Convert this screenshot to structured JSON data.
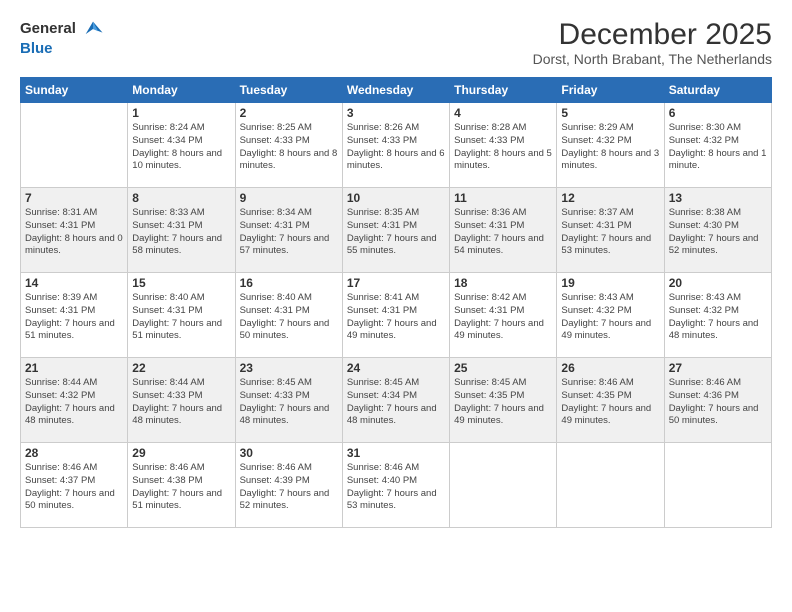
{
  "logo": {
    "text_general": "General",
    "text_blue": "Blue"
  },
  "header": {
    "title": "December 2025",
    "subtitle": "Dorst, North Brabant, The Netherlands"
  },
  "weekdays": [
    "Sunday",
    "Monday",
    "Tuesday",
    "Wednesday",
    "Thursday",
    "Friday",
    "Saturday"
  ],
  "weeks": [
    [
      {
        "day": "",
        "sunrise": "",
        "sunset": "",
        "daylight": ""
      },
      {
        "day": "1",
        "sunrise": "Sunrise: 8:24 AM",
        "sunset": "Sunset: 4:34 PM",
        "daylight": "Daylight: 8 hours and 10 minutes."
      },
      {
        "day": "2",
        "sunrise": "Sunrise: 8:25 AM",
        "sunset": "Sunset: 4:33 PM",
        "daylight": "Daylight: 8 hours and 8 minutes."
      },
      {
        "day": "3",
        "sunrise": "Sunrise: 8:26 AM",
        "sunset": "Sunset: 4:33 PM",
        "daylight": "Daylight: 8 hours and 6 minutes."
      },
      {
        "day": "4",
        "sunrise": "Sunrise: 8:28 AM",
        "sunset": "Sunset: 4:33 PM",
        "daylight": "Daylight: 8 hours and 5 minutes."
      },
      {
        "day": "5",
        "sunrise": "Sunrise: 8:29 AM",
        "sunset": "Sunset: 4:32 PM",
        "daylight": "Daylight: 8 hours and 3 minutes."
      },
      {
        "day": "6",
        "sunrise": "Sunrise: 8:30 AM",
        "sunset": "Sunset: 4:32 PM",
        "daylight": "Daylight: 8 hours and 1 minute."
      }
    ],
    [
      {
        "day": "7",
        "sunrise": "Sunrise: 8:31 AM",
        "sunset": "Sunset: 4:31 PM",
        "daylight": "Daylight: 8 hours and 0 minutes."
      },
      {
        "day": "8",
        "sunrise": "Sunrise: 8:33 AM",
        "sunset": "Sunset: 4:31 PM",
        "daylight": "Daylight: 7 hours and 58 minutes."
      },
      {
        "day": "9",
        "sunrise": "Sunrise: 8:34 AM",
        "sunset": "Sunset: 4:31 PM",
        "daylight": "Daylight: 7 hours and 57 minutes."
      },
      {
        "day": "10",
        "sunrise": "Sunrise: 8:35 AM",
        "sunset": "Sunset: 4:31 PM",
        "daylight": "Daylight: 7 hours and 55 minutes."
      },
      {
        "day": "11",
        "sunrise": "Sunrise: 8:36 AM",
        "sunset": "Sunset: 4:31 PM",
        "daylight": "Daylight: 7 hours and 54 minutes."
      },
      {
        "day": "12",
        "sunrise": "Sunrise: 8:37 AM",
        "sunset": "Sunset: 4:31 PM",
        "daylight": "Daylight: 7 hours and 53 minutes."
      },
      {
        "day": "13",
        "sunrise": "Sunrise: 8:38 AM",
        "sunset": "Sunset: 4:30 PM",
        "daylight": "Daylight: 7 hours and 52 minutes."
      }
    ],
    [
      {
        "day": "14",
        "sunrise": "Sunrise: 8:39 AM",
        "sunset": "Sunset: 4:31 PM",
        "daylight": "Daylight: 7 hours and 51 minutes."
      },
      {
        "day": "15",
        "sunrise": "Sunrise: 8:40 AM",
        "sunset": "Sunset: 4:31 PM",
        "daylight": "Daylight: 7 hours and 51 minutes."
      },
      {
        "day": "16",
        "sunrise": "Sunrise: 8:40 AM",
        "sunset": "Sunset: 4:31 PM",
        "daylight": "Daylight: 7 hours and 50 minutes."
      },
      {
        "day": "17",
        "sunrise": "Sunrise: 8:41 AM",
        "sunset": "Sunset: 4:31 PM",
        "daylight": "Daylight: 7 hours and 49 minutes."
      },
      {
        "day": "18",
        "sunrise": "Sunrise: 8:42 AM",
        "sunset": "Sunset: 4:31 PM",
        "daylight": "Daylight: 7 hours and 49 minutes."
      },
      {
        "day": "19",
        "sunrise": "Sunrise: 8:43 AM",
        "sunset": "Sunset: 4:32 PM",
        "daylight": "Daylight: 7 hours and 49 minutes."
      },
      {
        "day": "20",
        "sunrise": "Sunrise: 8:43 AM",
        "sunset": "Sunset: 4:32 PM",
        "daylight": "Daylight: 7 hours and 48 minutes."
      }
    ],
    [
      {
        "day": "21",
        "sunrise": "Sunrise: 8:44 AM",
        "sunset": "Sunset: 4:32 PM",
        "daylight": "Daylight: 7 hours and 48 minutes."
      },
      {
        "day": "22",
        "sunrise": "Sunrise: 8:44 AM",
        "sunset": "Sunset: 4:33 PM",
        "daylight": "Daylight: 7 hours and 48 minutes."
      },
      {
        "day": "23",
        "sunrise": "Sunrise: 8:45 AM",
        "sunset": "Sunset: 4:33 PM",
        "daylight": "Daylight: 7 hours and 48 minutes."
      },
      {
        "day": "24",
        "sunrise": "Sunrise: 8:45 AM",
        "sunset": "Sunset: 4:34 PM",
        "daylight": "Daylight: 7 hours and 48 minutes."
      },
      {
        "day": "25",
        "sunrise": "Sunrise: 8:45 AM",
        "sunset": "Sunset: 4:35 PM",
        "daylight": "Daylight: 7 hours and 49 minutes."
      },
      {
        "day": "26",
        "sunrise": "Sunrise: 8:46 AM",
        "sunset": "Sunset: 4:35 PM",
        "daylight": "Daylight: 7 hours and 49 minutes."
      },
      {
        "day": "27",
        "sunrise": "Sunrise: 8:46 AM",
        "sunset": "Sunset: 4:36 PM",
        "daylight": "Daylight: 7 hours and 50 minutes."
      }
    ],
    [
      {
        "day": "28",
        "sunrise": "Sunrise: 8:46 AM",
        "sunset": "Sunset: 4:37 PM",
        "daylight": "Daylight: 7 hours and 50 minutes."
      },
      {
        "day": "29",
        "sunrise": "Sunrise: 8:46 AM",
        "sunset": "Sunset: 4:38 PM",
        "daylight": "Daylight: 7 hours and 51 minutes."
      },
      {
        "day": "30",
        "sunrise": "Sunrise: 8:46 AM",
        "sunset": "Sunset: 4:39 PM",
        "daylight": "Daylight: 7 hours and 52 minutes."
      },
      {
        "day": "31",
        "sunrise": "Sunrise: 8:46 AM",
        "sunset": "Sunset: 4:40 PM",
        "daylight": "Daylight: 7 hours and 53 minutes."
      },
      {
        "day": "",
        "sunrise": "",
        "sunset": "",
        "daylight": ""
      },
      {
        "day": "",
        "sunrise": "",
        "sunset": "",
        "daylight": ""
      },
      {
        "day": "",
        "sunrise": "",
        "sunset": "",
        "daylight": ""
      }
    ]
  ]
}
